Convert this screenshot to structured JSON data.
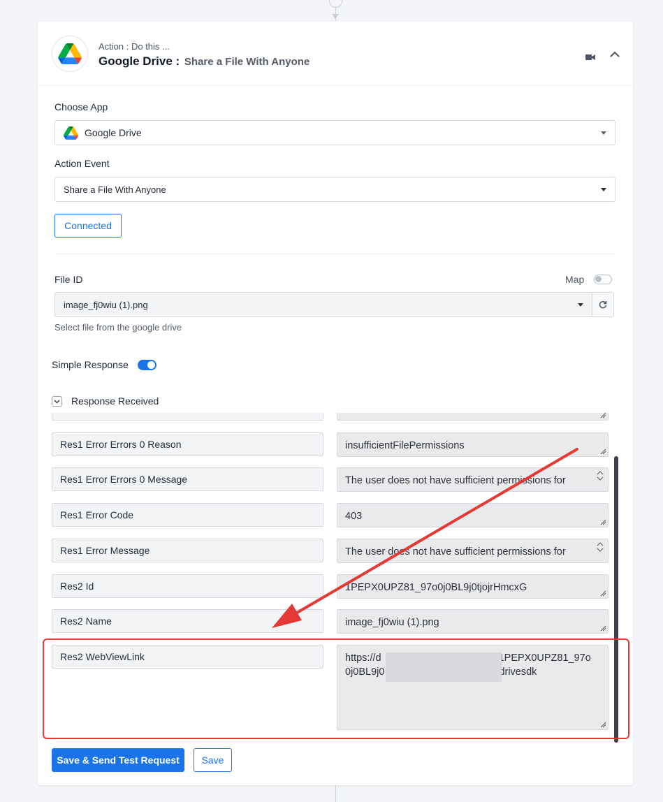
{
  "header": {
    "subtitle": "Action : Do this ...",
    "app_name": "Google Drive :",
    "action_desc": "Share a File With Anyone"
  },
  "choose_app": {
    "label": "Choose App",
    "value": "Google Drive"
  },
  "action_event": {
    "label": "Action Event",
    "value": "Share a File With Anyone"
  },
  "connected_label": "Connected",
  "file_id": {
    "label": "File ID",
    "map_label": "Map",
    "value": "image_fj0wiu (1).png",
    "hint": "Select file from the google drive"
  },
  "simple_response_label": "Simple Response",
  "response_received_label": "Response Received",
  "responses": [
    {
      "key": "Res1 Error Errors 0 Reason",
      "value": "insufficientFilePermissions"
    },
    {
      "key": "Res1 Error Errors 0 Message",
      "value": "The user does not have sufficient permissions for"
    },
    {
      "key": "Res1 Error Code",
      "value": "403"
    },
    {
      "key": "Res1 Error Message",
      "value": "The user does not have sufficient permissions for"
    },
    {
      "key": "Res2 Id",
      "value": "1PEPX0UPZ81_97o0j0BL9j0tjojrHmcxG"
    },
    {
      "key": "Res2 Name",
      "value": "image_fj0wiu (1).png"
    },
    {
      "key": "Res2 WebViewLink",
      "value_line1": "https://d",
      "value_line1_end": "1PEPX0UPZ81_97o",
      "value_line2": "0j0BL9j0",
      "value_line2_end": "drivesdk"
    }
  ],
  "buttons": {
    "save_send": "Save & Send Test Request",
    "save": "Save"
  },
  "colors": {
    "accent": "#1a73e8",
    "annotation": "#e53935"
  }
}
